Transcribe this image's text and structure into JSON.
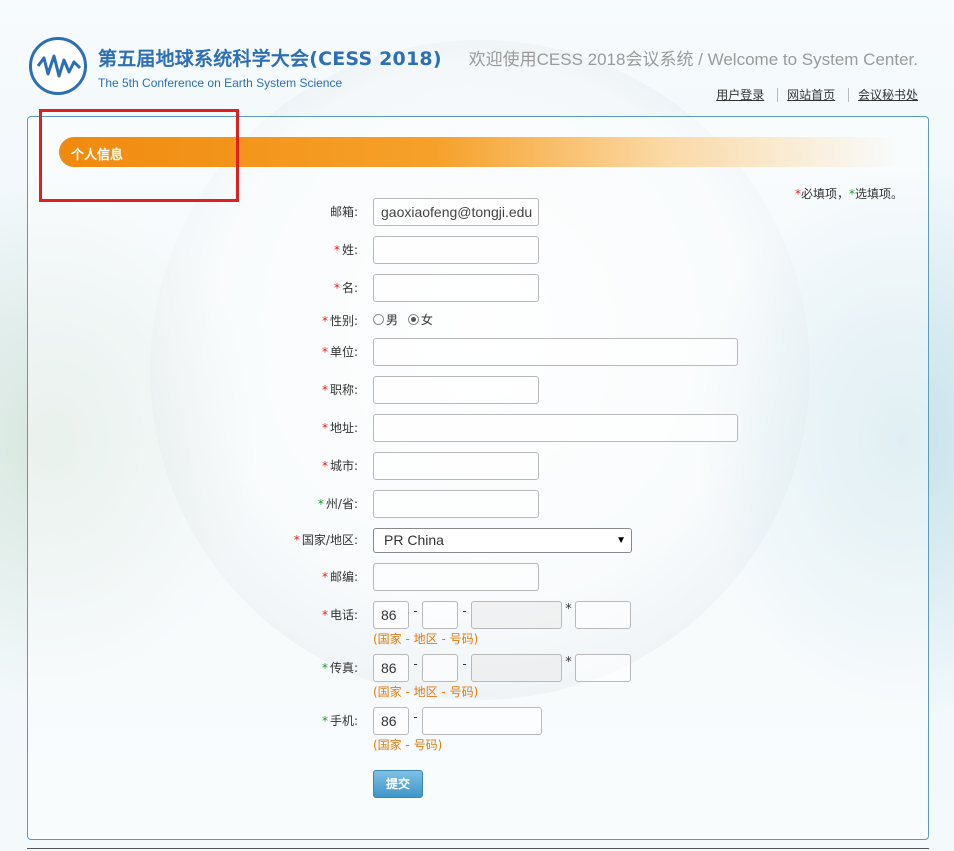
{
  "header": {
    "title": "第五届地球系统科学大会(CESS 2018)",
    "subtitle": "The 5th Conference on Earth System Science",
    "welcome": "欢迎使用CESS 2018会议系统 / Welcome to System Center.",
    "links": [
      "用户登录",
      "网站首页",
      "会议秘书处"
    ]
  },
  "section": {
    "title": "个人信息",
    "legend_required_mark": "*",
    "legend_required": "必填项，",
    "legend_optional_mark": "*",
    "legend_optional": "选填项。"
  },
  "form": {
    "email": {
      "label": "邮箱:",
      "value": "gaoxiaofeng@tongji.edu"
    },
    "surname": {
      "mark": "*",
      "label": "姓:",
      "value": ""
    },
    "given_name": {
      "mark": "*",
      "label": "名:",
      "value": ""
    },
    "gender": {
      "mark": "*",
      "label": "性别:",
      "options": [
        "男",
        "女"
      ],
      "selected": "女"
    },
    "organization": {
      "mark": "*",
      "label": "单位:",
      "value": ""
    },
    "title": {
      "mark": "*",
      "label": "职称:",
      "value": ""
    },
    "address": {
      "mark": "*",
      "label": "地址:",
      "value": ""
    },
    "city": {
      "mark": "*",
      "label": "城市:",
      "value": ""
    },
    "state": {
      "mark": "*",
      "label": "州/省:",
      "value": ""
    },
    "country": {
      "mark": "*",
      "label": "国家/地区:",
      "value": "PR China"
    },
    "zipcode": {
      "mark": "*",
      "label": "邮编:",
      "value": ""
    },
    "phone": {
      "mark": "*",
      "label": "电话:",
      "country_code": "86",
      "hint": "(国家 - 地区 - 号码)"
    },
    "fax": {
      "mark": "*",
      "label": "传真:",
      "country_code": "86",
      "hint": "(国家 - 地区 - 号码)"
    },
    "mobile": {
      "mark": "*",
      "label": "手机:",
      "country_code": "86",
      "hint": "(国家 - 号码)"
    },
    "submit_label": "提交",
    "dash": "-",
    "ext_mark": "*"
  },
  "colors": {
    "brand_blue": "#2d6fb4",
    "orange_bar": "#f08a0e",
    "required_red": "#e02020",
    "optional_green": "#1a9a2a",
    "hint_orange": "#e07a10",
    "highlight_box": "#e02020"
  },
  "icons": {
    "logo": "cess-logo-icon",
    "select_arrow": "dropdown-arrow-icon"
  }
}
